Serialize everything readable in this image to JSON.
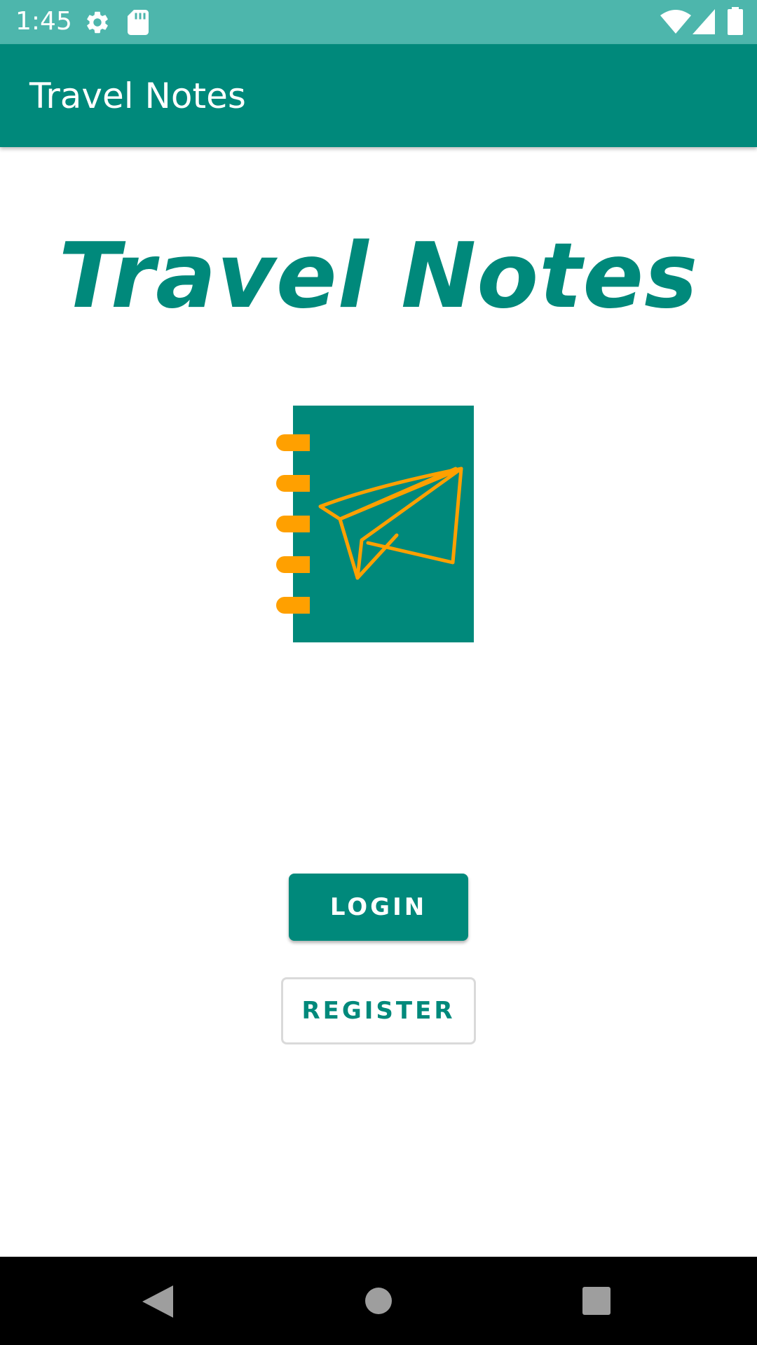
{
  "status_bar": {
    "time": "1:45",
    "icons": [
      "settings-icon",
      "sd-card-icon",
      "wifi-icon",
      "signal-icon",
      "battery-icon"
    ],
    "background": "#4DB6AC"
  },
  "app_bar": {
    "title": "Travel Notes",
    "background": "#00897B"
  },
  "main": {
    "title": "Travel Notes",
    "logo_icon": "notebook-paper-plane-icon",
    "login_label": "LOGIN",
    "register_label": "REGISTER"
  },
  "nav_bar": {
    "icons": [
      "back-icon",
      "home-icon",
      "recents-icon"
    ]
  },
  "colors": {
    "primary": "#00897B",
    "accent": "#FFA000",
    "status_bar": "#4DB6AC"
  }
}
